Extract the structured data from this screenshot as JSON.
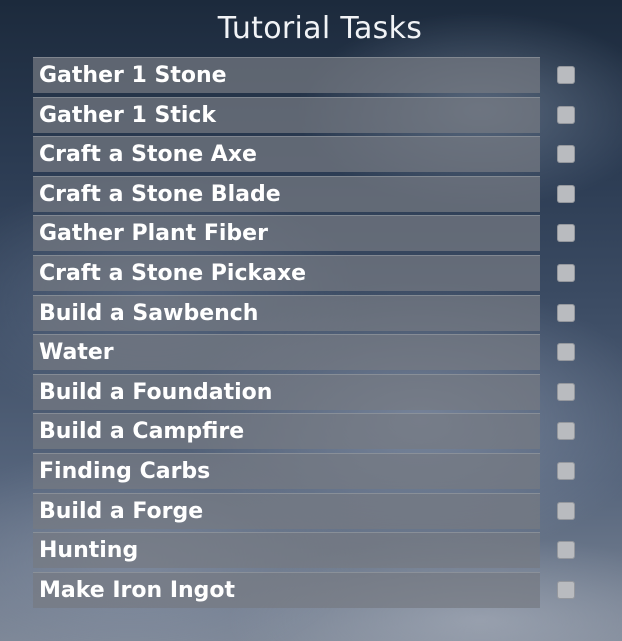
{
  "panel": {
    "title": "Tutorial Tasks"
  },
  "tasks": [
    {
      "label": "Gather 1 Stone",
      "completed": false
    },
    {
      "label": "Gather 1 Stick",
      "completed": false
    },
    {
      "label": "Craft a Stone Axe",
      "completed": false
    },
    {
      "label": "Craft a Stone Blade",
      "completed": false
    },
    {
      "label": "Gather Plant Fiber",
      "completed": false
    },
    {
      "label": "Craft a Stone Pickaxe",
      "completed": false
    },
    {
      "label": "Build a Sawbench",
      "completed": false
    },
    {
      "label": "Water",
      "completed": false
    },
    {
      "label": "Build a Foundation",
      "completed": false
    },
    {
      "label": "Build a Campfire",
      "completed": false
    },
    {
      "label": "Finding Carbs",
      "completed": false
    },
    {
      "label": "Build a Forge",
      "completed": false
    },
    {
      "label": "Hunting",
      "completed": false
    },
    {
      "label": "Make Iron Ingot",
      "completed": false
    }
  ],
  "colors": {
    "row_background": "#767a82",
    "checkbox": "#b9bbbf",
    "text": "#ffffff"
  }
}
